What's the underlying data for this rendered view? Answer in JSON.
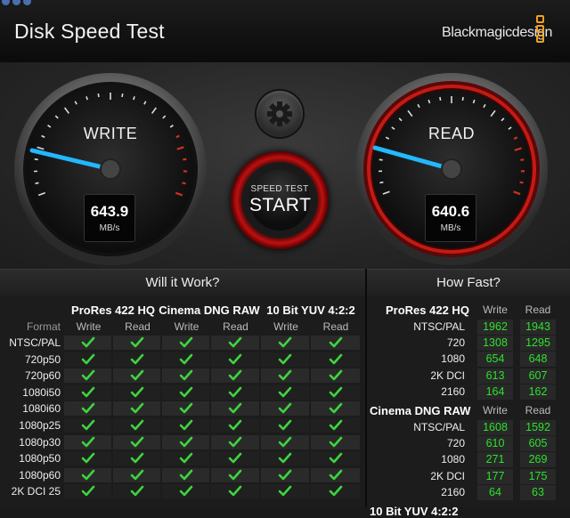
{
  "window": {
    "title": "Disk Speed Test",
    "brand": "Blackmagicdesign"
  },
  "gauges": {
    "write": {
      "label": "WRITE",
      "value": "643.9",
      "unit": "MB/s"
    },
    "read": {
      "label": "READ",
      "value": "640.6",
      "unit": "MB/s"
    }
  },
  "start_button": {
    "sub_label": "SPEED TEST",
    "main_label": "START"
  },
  "settings_icon": "gear-icon",
  "will_it_work": {
    "title": "Will it Work?",
    "format_header": "Format",
    "groups": [
      "ProRes 422 HQ",
      "Cinema DNG RAW",
      "10 Bit YUV 4:2:2"
    ],
    "sub_headers": [
      "Write",
      "Read",
      "Write",
      "Read",
      "Write",
      "Read"
    ],
    "rows": [
      "NTSC/PAL",
      "720p50",
      "720p60",
      "1080i50",
      "1080i60",
      "1080p25",
      "1080p30",
      "1080p50",
      "1080p60",
      "2K DCI 25"
    ],
    "all_supported": true,
    "check_color": "#3fd43f"
  },
  "how_fast": {
    "title": "How Fast?",
    "write_label": "Write",
    "read_label": "Read",
    "value_color": "#2ee02e",
    "groups": [
      {
        "name": "ProRes 422 HQ",
        "rows": [
          {
            "label": "NTSC/PAL",
            "write": "1962",
            "read": "1943"
          },
          {
            "label": "720",
            "write": "1308",
            "read": "1295"
          },
          {
            "label": "1080",
            "write": "654",
            "read": "648"
          },
          {
            "label": "2K DCI",
            "write": "613",
            "read": "607"
          },
          {
            "label": "2160",
            "write": "164",
            "read": "162"
          }
        ]
      },
      {
        "name": "Cinema DNG RAW",
        "rows": [
          {
            "label": "NTSC/PAL",
            "write": "1608",
            "read": "1592"
          },
          {
            "label": "720",
            "write": "610",
            "read": "605"
          },
          {
            "label": "1080",
            "write": "271",
            "read": "269"
          },
          {
            "label": "2K DCI",
            "write": "177",
            "read": "175"
          },
          {
            "label": "2160",
            "write": "64",
            "read": "63"
          }
        ]
      },
      {
        "name": "10 Bit YUV 4:2:2"
      }
    ]
  }
}
